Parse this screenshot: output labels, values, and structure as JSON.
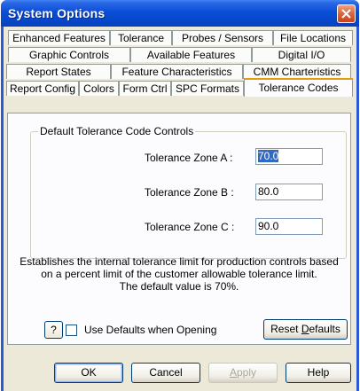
{
  "window": {
    "title": "System Options"
  },
  "tabs": {
    "row1": [
      "Enhanced Features",
      "Tolerance",
      "Probes / Sensors",
      "File Locations"
    ],
    "row2": [
      "Graphic Controls",
      "Available Features",
      "Digital I/O"
    ],
    "row3": [
      "Report States",
      "Feature Characteristics",
      "CMM Charteristics"
    ],
    "row4": [
      "Report Config",
      "Colors",
      "Form Ctrl",
      "SPC Formats",
      "Tolerance Codes"
    ],
    "selected": "Tolerance Codes"
  },
  "group": {
    "title": "Default Tolerance Code Controls"
  },
  "zones": [
    {
      "label": "Tolerance Zone A :",
      "value": "70.0",
      "selected": true
    },
    {
      "label": "Tolerance Zone B :",
      "value": "80.0",
      "selected": false
    },
    {
      "label": "Tolerance Zone C :",
      "value": "90.0",
      "selected": false
    }
  ],
  "description": {
    "line1": "Establishes the internal tolerance limit for production controls based",
    "line2": "on a percent limit of the customer allowable tolerance limit.",
    "line3": "The default value is 70%."
  },
  "help_button": "?",
  "use_defaults": {
    "label": "Use Defaults when Opening",
    "checked": false
  },
  "reset_button": {
    "prefix": "Reset ",
    "accel": "D",
    "suffix": "efaults"
  },
  "footer": {
    "ok": "OK",
    "cancel": "Cancel",
    "apply": {
      "prefix": "",
      "accel": "A",
      "suffix": "pply"
    },
    "help": "Help"
  },
  "colors": {
    "title_bar": "#0a4ed6",
    "close_button": "#e0623a",
    "dialog_bg": "#ece9d8",
    "selection": "#316ac5"
  }
}
